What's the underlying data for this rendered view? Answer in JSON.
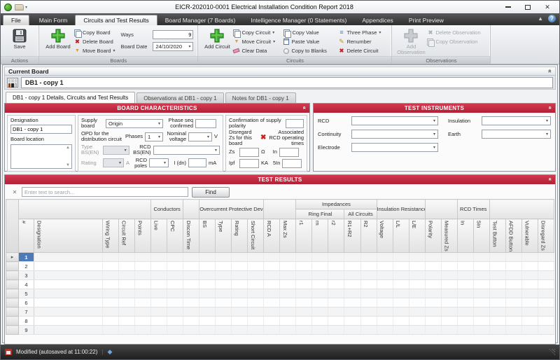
{
  "window": {
    "title": "EICR-202010-0001 Electrical Installation Condition Report 2018",
    "controls": {
      "minimize": "minimize",
      "maximize": "maximize",
      "close": "close"
    }
  },
  "ribbon": {
    "tabs": {
      "items": [
        "File",
        "Main Form",
        "Circuits and Test Results",
        "Board Manager (7 Boards)",
        "Intelligence Manager (0 Statements)",
        "Appendices",
        "Print Preview"
      ],
      "active_index": 2
    },
    "actions": {
      "label": "Actions",
      "save_label": "Save"
    },
    "boards": {
      "label": "Boards",
      "add_label": "Add Board",
      "copy_label": "Copy Board",
      "delete_label": "Delete Board",
      "move_label": "Move Board",
      "ways_label": "Ways",
      "ways_value": "9",
      "date_label": "Board Date",
      "date_value": "24/10/2020"
    },
    "circuits": {
      "label": "Circuits",
      "add_label": "Add Circuit",
      "copy_circuit": "Copy Circuit",
      "move_circuit": "Move Circuit",
      "clear_data": "Clear Data",
      "copy_value": "Copy Value",
      "paste_value": "Paste Value",
      "copy_to_blanks": "Copy to Blanks",
      "three_phase": "Three Phase",
      "renumber": "Renumber",
      "delete_circuit": "Delete Circuit"
    },
    "observations": {
      "label": "Observations",
      "add_label": "Add Observation",
      "delete_label": "Delete Observation",
      "copy_label": "Copy Observation"
    }
  },
  "current_board": {
    "header": "Current Board",
    "selected": "DB1 - copy 1"
  },
  "board_tabs": {
    "items": [
      "DB1 - copy 1 Details, Circuits and Test Results",
      "Observations at DB1 - copy 1",
      "Notes for DB1 - copy 1"
    ],
    "active_index": 0
  },
  "board_characteristics": {
    "title": "BOARD CHARACTERISTICS",
    "designation_label": "Designation",
    "designation_value": "DB1 - copy 1",
    "board_location_label": "Board location",
    "supply_board_label": "Supply board",
    "supply_board_value": "Origin",
    "phase_seq_label": "Phase seq confirmed",
    "opd_label": "OPD for the distribution circuit",
    "phases_label": "Phases",
    "phases_value": "1",
    "nominal_voltage_label": "Nominal voltage",
    "volts_unit": "V",
    "type_bsen_label": "Type BS(EN)",
    "rcd_bsen_label": "RCD BS(EN)",
    "rating_label": "Rating",
    "amps_unit": "A",
    "rcd_poles_label": "RCD poles",
    "idn_label": "I (dn)",
    "ma_unit": "mA",
    "confirmation_label": "Confirmation of supply polarity",
    "disregard_label": "Disregard Zs for this board",
    "associated_label": "Associated RCD operating times",
    "zs_label": "Zs",
    "ohm_unit": "Ω",
    "in_label": "In",
    "ipf_label": "Ipf",
    "ka_unit": "KA",
    "fivein_label": "5In"
  },
  "test_instruments": {
    "title": "TEST INSTRUMENTS",
    "rcd_label": "RCD",
    "insulation_label": "Insulation",
    "continuity_label": "Continuity",
    "earth_label": "Earth",
    "electrode_label": "Electrode"
  },
  "test_results": {
    "title": "TEST RESULTS",
    "search_placeholder": "Enter text to search...",
    "find_label": "Find",
    "grid": {
      "columns": [
        {
          "label": "#"
        },
        {
          "label": "Designation"
        },
        {
          "label": "Wiring Type"
        },
        {
          "label": "Circuit Ref"
        },
        {
          "label": "Points"
        },
        {
          "label": "Live",
          "group": "Conductors"
        },
        {
          "label": "CPC",
          "group": "Conductors"
        },
        {
          "label": "Discon Time"
        },
        {
          "label": "BS",
          "group": "Overcurrent Protective Device"
        },
        {
          "label": "Type",
          "group": "Overcurrent Protective Device"
        },
        {
          "label": "Rating",
          "group": "Overcurrent Protective Device"
        },
        {
          "label": "Short Circuit",
          "group": "Overcurrent Protective Device"
        },
        {
          "label": "RCD A"
        },
        {
          "label": "Max Zs"
        },
        {
          "label": "r1",
          "group": "Impedances",
          "subgroup": "Ring Final"
        },
        {
          "label": "rn",
          "group": "Impedances",
          "subgroup": "Ring Final"
        },
        {
          "label": "r2",
          "group": "Impedances",
          "subgroup": "Ring Final"
        },
        {
          "label": "R1+R2",
          "group": "Impedances",
          "subgroup": "All Circuits"
        },
        {
          "label": "R2",
          "group": "Impedances",
          "subgroup": "All Circuits"
        },
        {
          "label": "Voltage",
          "group": "Insulation Resistance"
        },
        {
          "label": "L/L",
          "group": "Insulation Resistance"
        },
        {
          "label": "L/E",
          "group": "Insulation Resistance"
        },
        {
          "label": "Polarity"
        },
        {
          "label": "Measured Zs"
        },
        {
          "label": "In",
          "group": "RCD Times"
        },
        {
          "label": "5In",
          "group": "RCD Times"
        },
        {
          "label": "Test Button"
        },
        {
          "label": "AFDD Button"
        },
        {
          "label": "Vulnerable"
        },
        {
          "label": "Disregard Zs"
        }
      ],
      "rows": {
        "numbers": [
          "1",
          "2",
          "3",
          "4",
          "5",
          "6",
          "7",
          "8",
          "9"
        ],
        "selected": "1",
        "selection_marker": "▸"
      }
    }
  },
  "status_bar": {
    "text": "Modified (autosaved at 11:00:22)"
  }
}
